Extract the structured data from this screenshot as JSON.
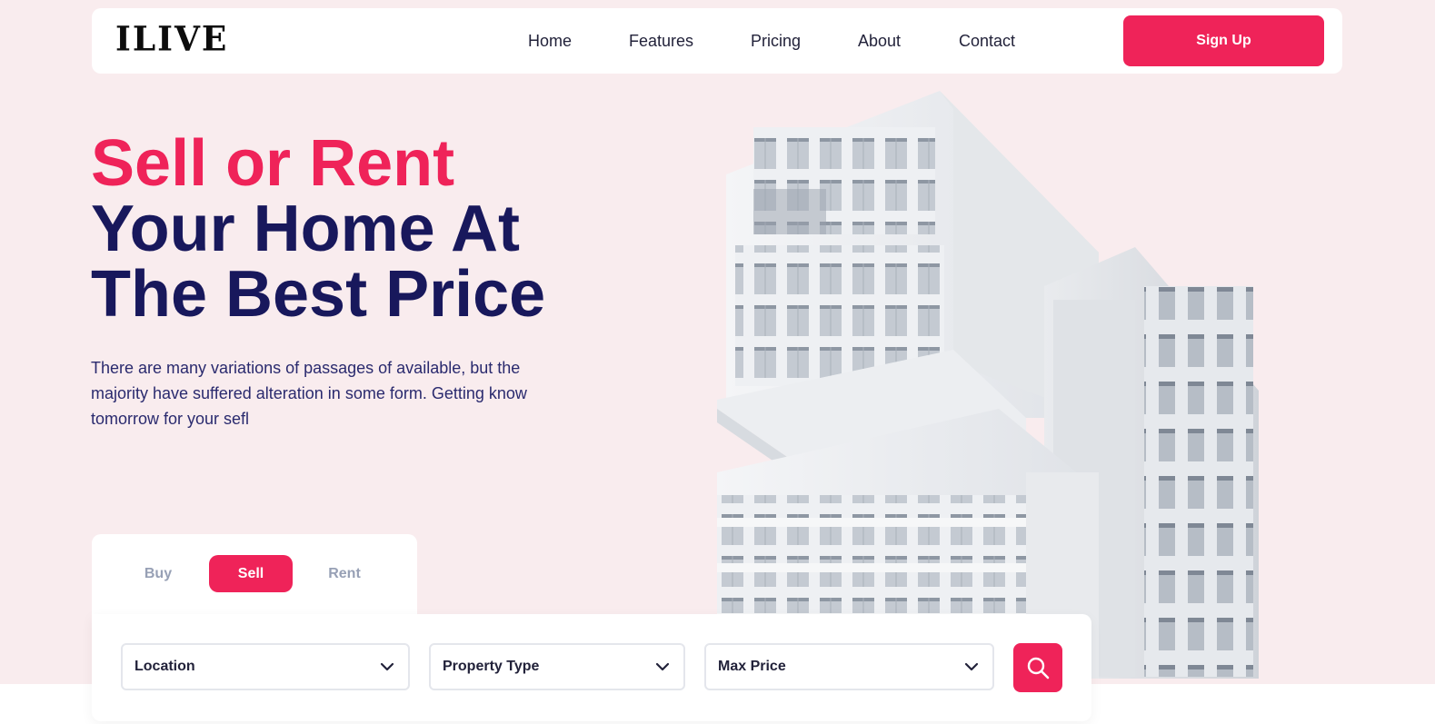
{
  "brand": {
    "logo_text": "ILIVE"
  },
  "nav": {
    "links": [
      "Home",
      "Features",
      "Pricing",
      "About",
      "Contact"
    ],
    "signup_label": "Sign Up"
  },
  "hero": {
    "headline_accent": "Sell or Rent",
    "headline_line2": "Your Home At",
    "headline_line3": "The Best Price",
    "description": "There are many variations of passages of available, but the majority have suffered alteration in some form. Getting know tomorrow for your sefl"
  },
  "search": {
    "tabs": [
      "Buy",
      "Sell",
      "Rent"
    ],
    "active_tab": "Sell",
    "fields": {
      "location": "Location",
      "property_type": "Property Type",
      "max_price": "Max Price"
    }
  },
  "colors": {
    "accent": "#ef2359",
    "navy": "#18185c",
    "hero_bg": "#f9ecee"
  },
  "icons": {
    "dropdown": "chevron-down-icon",
    "search": "search-icon"
  }
}
